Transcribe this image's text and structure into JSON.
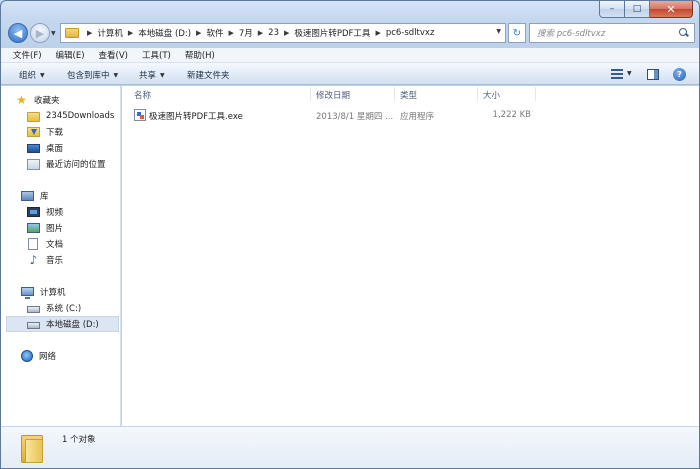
{
  "window": {
    "caption": {
      "minimize": "–",
      "maximize": "□",
      "close": "✕"
    }
  },
  "address": {
    "crumbs": [
      "计算机",
      "本地磁盘 (D:)",
      "软件",
      "7月",
      "23",
      "极速图片转PDF工具",
      "pc6-sdltvxz"
    ]
  },
  "search": {
    "placeholder": "搜索 pc6-sdltvxz"
  },
  "menubar": {
    "items": [
      "文件(F)",
      "编辑(E)",
      "查看(V)",
      "工具(T)",
      "帮助(H)"
    ]
  },
  "commandbar": {
    "organize": "组织",
    "include_in_library": "包含到库中",
    "share": "共享",
    "new_folder": "新建文件夹"
  },
  "navpane": {
    "favorites": {
      "label": "收藏夹",
      "items": [
        "2345Downloads",
        "下载",
        "桌面",
        "最近访问的位置"
      ]
    },
    "libraries": {
      "label": "库",
      "items": [
        "视频",
        "图片",
        "文档",
        "音乐"
      ]
    },
    "computer": {
      "label": "计算机",
      "items": [
        "系统 (C:)",
        "本地磁盘 (D:)"
      ]
    },
    "network": {
      "label": "网络"
    }
  },
  "filelist": {
    "columns": [
      "名称",
      "修改日期",
      "类型",
      "大小"
    ],
    "rows": [
      {
        "name": "极速图片转PDF工具.exe",
        "date": "2013/8/1 星期四 ...",
        "type": "应用程序",
        "size": "1,222 KB"
      }
    ]
  },
  "details": {
    "count": "1 个对象"
  },
  "colors": {
    "accent": "#2b6cc4",
    "selection": "#dbe6f2",
    "close": "#c2462e"
  }
}
